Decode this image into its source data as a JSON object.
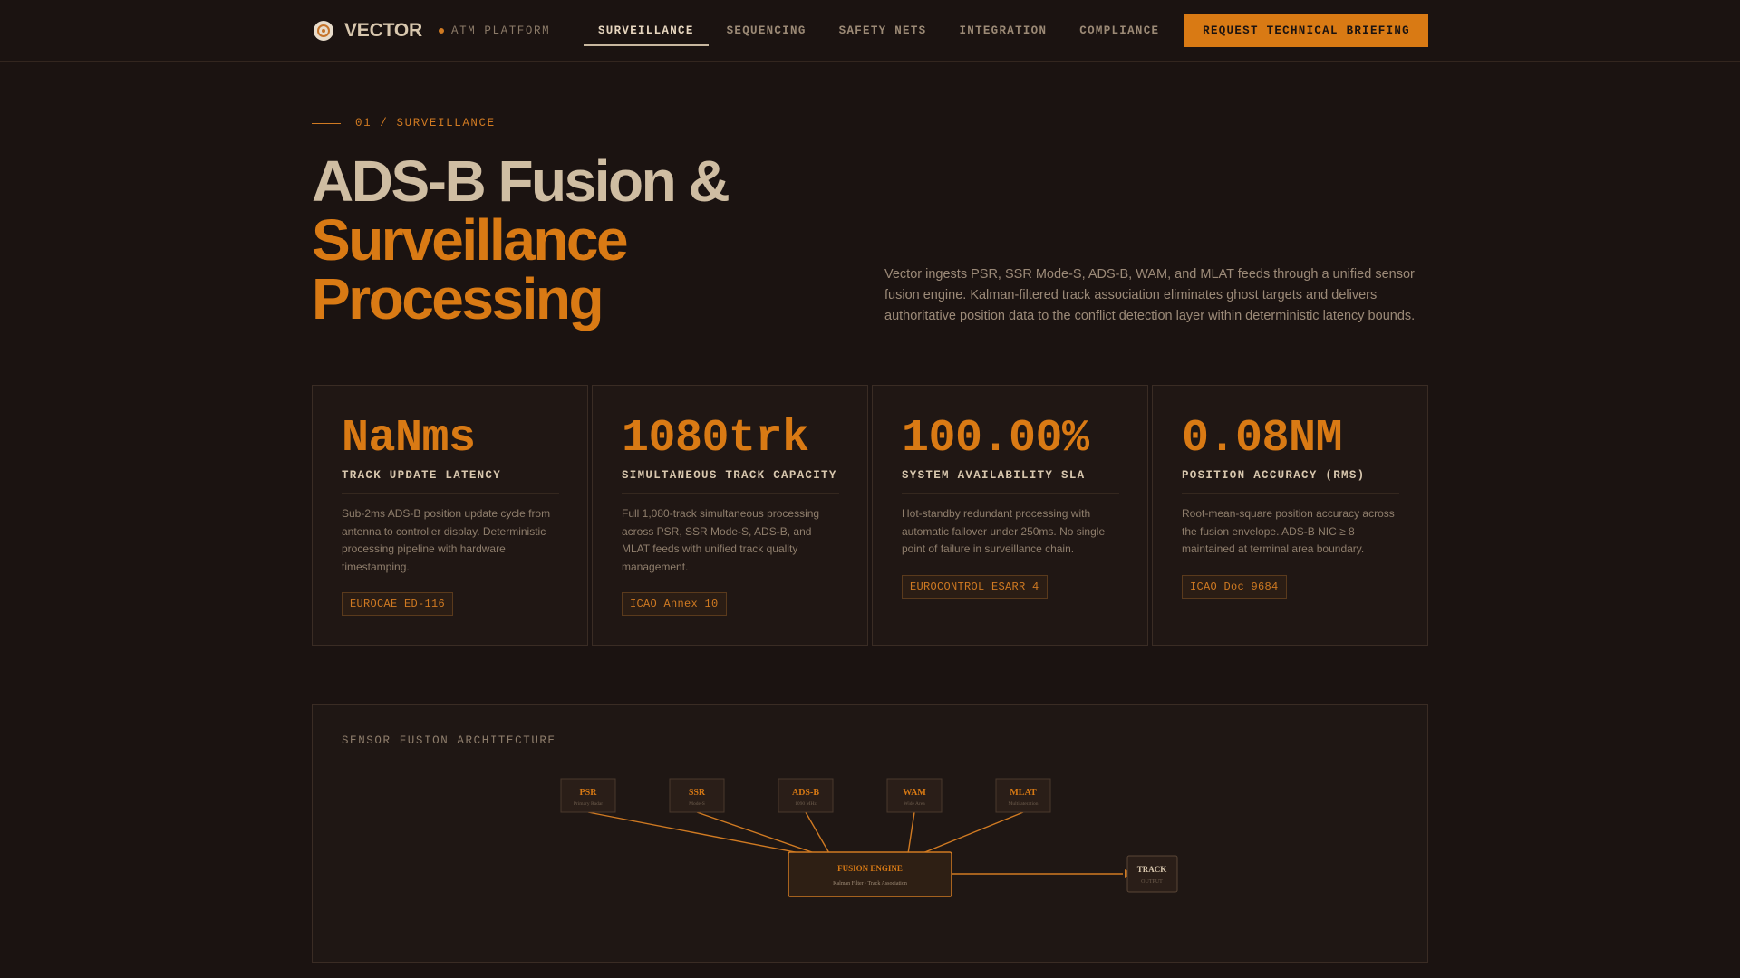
{
  "nav": {
    "brand": "VECTOR",
    "platform": "ATM PLATFORM",
    "items": [
      {
        "label": "SURVEILLANCE",
        "active": true
      },
      {
        "label": "SEQUENCING",
        "active": false
      },
      {
        "label": "SAFETY NETS",
        "active": false
      },
      {
        "label": "INTEGRATION",
        "active": false
      },
      {
        "label": "COMPLIANCE",
        "active": false
      }
    ],
    "cta": "REQUEST TECHNICAL BRIEFING",
    "icon": "radar-logo-icon"
  },
  "hero": {
    "eyebrow": "01 / SURVEILLANCE",
    "title_line1": "ADS-B Fusion &",
    "title_line2": "Surveillance",
    "title_line3": "Processing",
    "description": "Vector ingests PSR, SSR Mode-S, ADS-B, WAM, and MLAT feeds through a unified sensor fusion engine. Kalman-filtered track association eliminates ghost targets and delivers authoritative position data to the conflict detection layer within deterministic latency bounds."
  },
  "metrics": [
    {
      "value": "NaNms",
      "label": "TRACK UPDATE LATENCY",
      "desc": "Sub-2ms ADS-B position update cycle from antenna to controller display. Deterministic processing pipeline with hardware timestamping.",
      "tag": "EUROCAE ED-116"
    },
    {
      "value": "1080trk",
      "label": "SIMULTANEOUS TRACK CAPACITY",
      "desc": "Full 1,080-track simultaneous processing across PSR, SSR Mode-S, ADS-B, and MLAT feeds with unified track quality management.",
      "tag": "ICAO Annex 10"
    },
    {
      "value": "100.00%",
      "label": "SYSTEM AVAILABILITY SLA",
      "desc": "Hot-standby redundant processing with automatic failover under 250ms. No single point of failure in surveillance chain.",
      "tag": "EUROCONTROL ESARR 4"
    },
    {
      "value": "0.08NM",
      "label": "POSITION ACCURACY (RMS)",
      "desc": "Root-mean-square position accuracy across the fusion envelope. ADS-B NIC ≥ 8 maintained at terminal area boundary.",
      "tag": "ICAO Doc 9684"
    }
  ],
  "architecture": {
    "title": "SENSOR FUSION ARCHITECTURE",
    "sensors": [
      {
        "name": "PSR",
        "sub": "Primary Radar"
      },
      {
        "name": "SSR",
        "sub": "Mode-S"
      },
      {
        "name": "ADS-B",
        "sub": "1090 MHz"
      },
      {
        "name": "WAM",
        "sub": "Wide Area"
      },
      {
        "name": "MLAT",
        "sub": "Multilateration"
      }
    ],
    "engine": {
      "name": "FUSION ENGINE",
      "sub": "Kalman Filter · Track Association"
    },
    "output": {
      "name": "TRACK",
      "sub": "OUTPUT"
    }
  },
  "colors": {
    "background": "#1b1311",
    "accent": "#d97a14",
    "text": "#cfbda2"
  }
}
